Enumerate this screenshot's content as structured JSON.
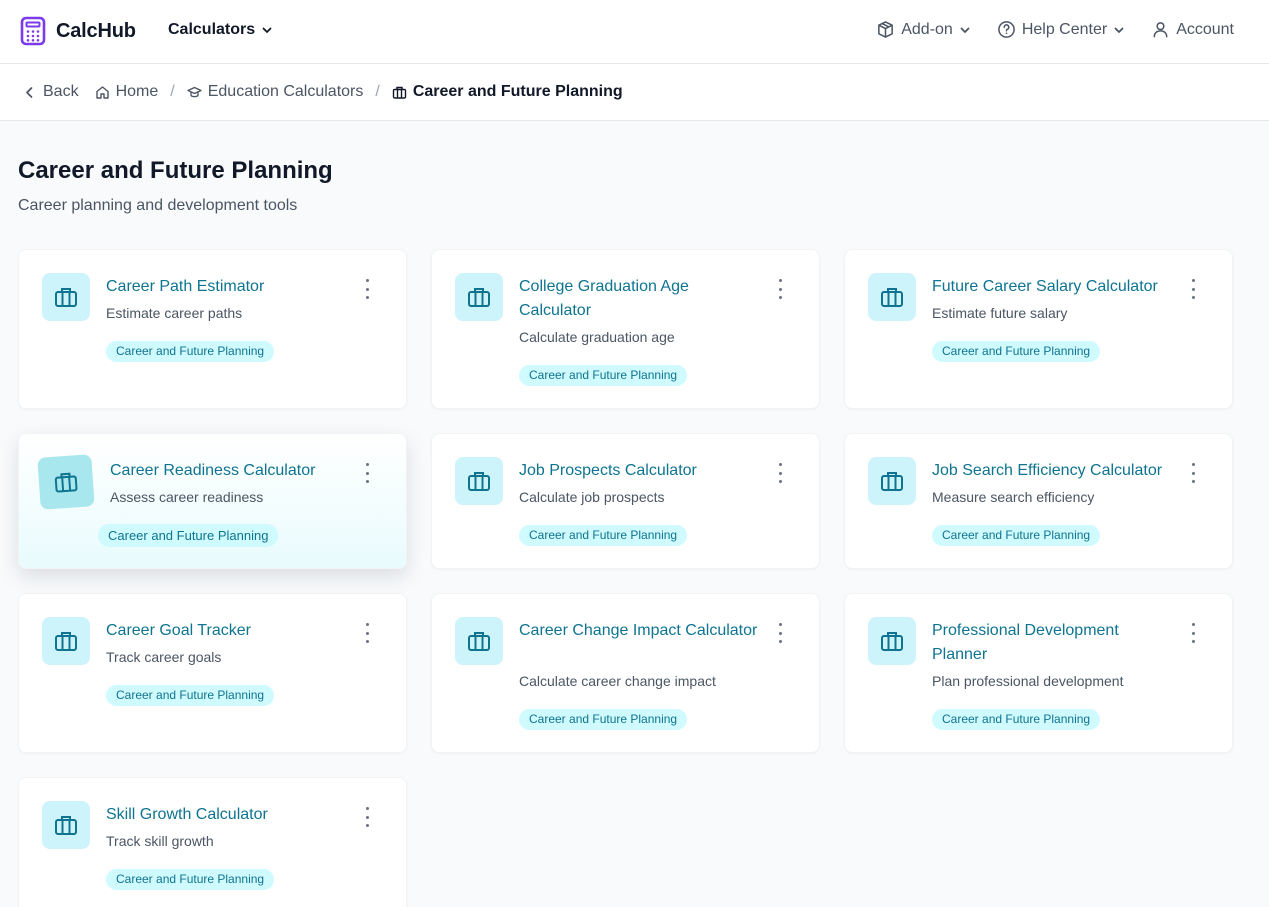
{
  "app": {
    "name": "CalcHub"
  },
  "nav": {
    "calculators": "Calculators",
    "addon": "Add-on",
    "help": "Help Center",
    "account": "Account"
  },
  "breadcrumb": {
    "back": "Back",
    "home": "Home",
    "education": "Education Calculators",
    "current": "Career and Future Planning"
  },
  "page": {
    "title": "Career and Future Planning",
    "subtitle": "Career planning and development tools"
  },
  "cards": [
    {
      "title": "Career Path Estimator",
      "desc": "Estimate career paths",
      "tag": "Career and Future Planning"
    },
    {
      "title": "College Graduation Age Calculator",
      "desc": "Calculate graduation age",
      "tag": "Career and Future Planning"
    },
    {
      "title": "Future Career Salary Calculator",
      "desc": "Estimate future salary",
      "tag": "Career and Future Planning"
    },
    {
      "title": "Career Readiness Calculator",
      "desc": "Assess career readiness",
      "tag": "Career and Future Planning"
    },
    {
      "title": "Job Prospects Calculator",
      "desc": "Calculate job prospects",
      "tag": "Career and Future Planning"
    },
    {
      "title": "Job Search Efficiency Calculator",
      "desc": "Measure search efficiency",
      "tag": "Career and Future Planning"
    },
    {
      "title": "Career Goal Tracker",
      "desc": "Track career goals",
      "tag": "Career and Future Planning"
    },
    {
      "title": "Career Change Impact Calculator",
      "desc": "Calculate career change impact",
      "tag": "Career and Future Planning"
    },
    {
      "title": "Professional Development Planner",
      "desc": "Plan professional development",
      "tag": "Career and Future Planning"
    },
    {
      "title": "Skill Growth Calculator",
      "desc": "Track skill growth",
      "tag": "Career and Future Planning"
    }
  ],
  "icons": {
    "logo": "calculator-icon",
    "card": "briefcase-icon",
    "addon": "package-icon",
    "help": "help-circle-icon",
    "account": "user-icon"
  },
  "colors": {
    "brand": "#7c3aed",
    "accent": "#0e7490",
    "tag_bg": "#cffafe",
    "icon_bg": "#cdf4fa"
  }
}
